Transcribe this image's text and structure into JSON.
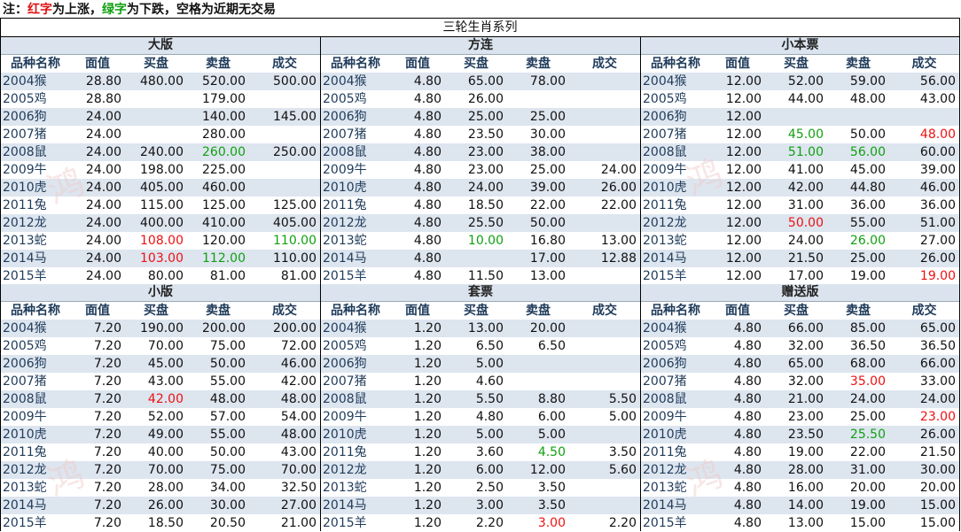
{
  "note": {
    "prefix": "注：",
    "red_word": "红字",
    "mid1": "为上涨，",
    "green_word": "绿字",
    "mid2": "为下跌，空格为近期无交易"
  },
  "title": "三轮生肖系列",
  "headers": [
    "品种名称",
    "面值",
    "买盘",
    "卖盘",
    "成交"
  ],
  "colors": {
    "up": "#ee1111",
    "down": "#11a011",
    "stripe": "#dde5ef",
    "header_text": "#1f3b5a"
  },
  "panels": [
    {
      "name": "大版",
      "rows": [
        {
          "cells": [
            "2004猴",
            "28.80",
            "480.00",
            "520.00",
            "500.00"
          ]
        },
        {
          "cells": [
            "2005鸡",
            "28.80",
            "",
            "179.00",
            ""
          ]
        },
        {
          "cells": [
            "2006狗",
            "24.00",
            "",
            "140.00",
            "145.00"
          ]
        },
        {
          "cells": [
            "2007猪",
            "24.00",
            "",
            "280.00",
            ""
          ]
        },
        {
          "cells": [
            "2008鼠",
            "24.00",
            "240.00",
            "260.00",
            "250.00"
          ],
          "colors": {
            "3": "green"
          }
        },
        {
          "cells": [
            "2009牛",
            "24.00",
            "198.00",
            "225.00",
            ""
          ]
        },
        {
          "cells": [
            "2010虎",
            "24.00",
            "405.00",
            "460.00",
            ""
          ]
        },
        {
          "cells": [
            "2011兔",
            "24.00",
            "115.00",
            "125.00",
            "125.00"
          ]
        },
        {
          "cells": [
            "2012龙",
            "24.00",
            "400.00",
            "410.00",
            "405.00"
          ]
        },
        {
          "cells": [
            "2013蛇",
            "24.00",
            "108.00",
            "120.00",
            "110.00"
          ],
          "colors": {
            "2": "red",
            "4": "green"
          }
        },
        {
          "cells": [
            "2014马",
            "24.00",
            "103.00",
            "112.00",
            "110.00"
          ],
          "colors": {
            "2": "red",
            "3": "green"
          }
        },
        {
          "cells": [
            "2015羊",
            "24.00",
            "80.00",
            "81.00",
            "81.00"
          ]
        }
      ]
    },
    {
      "name": "方连",
      "rows": [
        {
          "cells": [
            "2004猴",
            "4.80",
            "65.00",
            "78.00",
            ""
          ]
        },
        {
          "cells": [
            "2005鸡",
            "4.80",
            "26.00",
            "",
            ""
          ]
        },
        {
          "cells": [
            "2006狗",
            "4.80",
            "25.00",
            "25.00",
            ""
          ]
        },
        {
          "cells": [
            "2007猪",
            "4.80",
            "23.50",
            "30.00",
            ""
          ]
        },
        {
          "cells": [
            "2008鼠",
            "4.80",
            "23.00",
            "38.00",
            ""
          ]
        },
        {
          "cells": [
            "2009牛",
            "4.80",
            "23.00",
            "25.00",
            "24.00"
          ]
        },
        {
          "cells": [
            "2010虎",
            "4.80",
            "24.00",
            "39.00",
            "26.00"
          ]
        },
        {
          "cells": [
            "2011兔",
            "4.80",
            "18.50",
            "22.00",
            "22.00"
          ]
        },
        {
          "cells": [
            "2012龙",
            "4.80",
            "25.50",
            "50.00",
            ""
          ]
        },
        {
          "cells": [
            "2013蛇",
            "4.80",
            "10.00",
            "16.80",
            "13.00"
          ],
          "colors": {
            "2": "green"
          }
        },
        {
          "cells": [
            "2014马",
            "4.80",
            "",
            "17.00",
            "12.88"
          ]
        },
        {
          "cells": [
            "2015羊",
            "4.80",
            "11.50",
            "13.00",
            ""
          ]
        }
      ]
    },
    {
      "name": "小本票",
      "rows": [
        {
          "cells": [
            "2004猴",
            "12.00",
            "52.00",
            "59.00",
            "56.00"
          ]
        },
        {
          "cells": [
            "2005鸡",
            "12.00",
            "44.00",
            "48.00",
            "43.00"
          ]
        },
        {
          "cells": [
            "2006狗",
            "12.00",
            "",
            "",
            ""
          ]
        },
        {
          "cells": [
            "2007猪",
            "12.00",
            "45.00",
            "50.00",
            "48.00"
          ],
          "colors": {
            "2": "green",
            "4": "red"
          }
        },
        {
          "cells": [
            "2008鼠",
            "12.00",
            "51.00",
            "56.00",
            "60.00"
          ],
          "colors": {
            "2": "green",
            "3": "green"
          }
        },
        {
          "cells": [
            "2009牛",
            "12.00",
            "41.00",
            "45.00",
            "39.00"
          ]
        },
        {
          "cells": [
            "2010虎",
            "12.00",
            "42.00",
            "44.80",
            "46.00"
          ]
        },
        {
          "cells": [
            "2011兔",
            "12.00",
            "31.00",
            "36.00",
            "36.00"
          ]
        },
        {
          "cells": [
            "2012龙",
            "12.00",
            "50.00",
            "55.00",
            "51.00"
          ],
          "colors": {
            "2": "red"
          }
        },
        {
          "cells": [
            "2013蛇",
            "12.00",
            "24.00",
            "26.00",
            "27.00"
          ],
          "colors": {
            "3": "green"
          }
        },
        {
          "cells": [
            "2014马",
            "12.00",
            "21.50",
            "25.00",
            "26.00"
          ]
        },
        {
          "cells": [
            "2015羊",
            "12.00",
            "17.00",
            "19.00",
            "19.00"
          ],
          "colors": {
            "4": "red"
          }
        }
      ]
    },
    {
      "name": "小版",
      "rows": [
        {
          "cells": [
            "2004猴",
            "7.20",
            "190.00",
            "200.00",
            "200.00"
          ]
        },
        {
          "cells": [
            "2005鸡",
            "7.20",
            "70.00",
            "75.00",
            "72.00"
          ]
        },
        {
          "cells": [
            "2006狗",
            "7.20",
            "45.00",
            "50.00",
            "46.00"
          ]
        },
        {
          "cells": [
            "2007猪",
            "7.20",
            "43.00",
            "55.00",
            "42.00"
          ]
        },
        {
          "cells": [
            "2008鼠",
            "7.20",
            "42.00",
            "48.00",
            "48.00"
          ],
          "colors": {
            "2": "red"
          }
        },
        {
          "cells": [
            "2009牛",
            "7.20",
            "52.00",
            "57.00",
            "54.00"
          ]
        },
        {
          "cells": [
            "2010虎",
            "7.20",
            "49.00",
            "55.00",
            "48.00"
          ]
        },
        {
          "cells": [
            "2011兔",
            "7.20",
            "40.00",
            "50.00",
            "43.00"
          ]
        },
        {
          "cells": [
            "2012龙",
            "7.20",
            "70.00",
            "75.00",
            "70.00"
          ]
        },
        {
          "cells": [
            "2013蛇",
            "7.20",
            "28.00",
            "34.00",
            "32.50"
          ]
        },
        {
          "cells": [
            "2014马",
            "7.20",
            "26.00",
            "30.00",
            "27.00"
          ]
        },
        {
          "cells": [
            "2015羊",
            "7.20",
            "18.50",
            "20.50",
            "21.00"
          ]
        }
      ]
    },
    {
      "name": "套票",
      "rows": [
        {
          "cells": [
            "2004猴",
            "1.20",
            "13.00",
            "20.00",
            ""
          ]
        },
        {
          "cells": [
            "2005鸡",
            "1.20",
            "6.50",
            "6.50",
            ""
          ]
        },
        {
          "cells": [
            "2006狗",
            "1.20",
            "5.00",
            "",
            ""
          ]
        },
        {
          "cells": [
            "2007猪",
            "1.20",
            "4.60",
            "",
            ""
          ]
        },
        {
          "cells": [
            "2008鼠",
            "1.20",
            "5.50",
            "8.80",
            "5.50"
          ]
        },
        {
          "cells": [
            "2009牛",
            "1.20",
            "4.80",
            "6.00",
            "5.00"
          ]
        },
        {
          "cells": [
            "2010虎",
            "1.20",
            "5.00",
            "5.00",
            ""
          ]
        },
        {
          "cells": [
            "2011兔",
            "1.20",
            "3.60",
            "4.50",
            "3.50"
          ],
          "colors": {
            "3": "green"
          }
        },
        {
          "cells": [
            "2012龙",
            "1.20",
            "6.00",
            "12.00",
            "5.60"
          ]
        },
        {
          "cells": [
            "2013蛇",
            "1.20",
            "2.50",
            "3.50",
            ""
          ]
        },
        {
          "cells": [
            "2014马",
            "1.20",
            "3.00",
            "3.50",
            ""
          ]
        },
        {
          "cells": [
            "2015羊",
            "1.20",
            "2.20",
            "3.00",
            "2.20"
          ],
          "colors": {
            "3": "red"
          }
        }
      ]
    },
    {
      "name": "赠送版",
      "rows": [
        {
          "cells": [
            "2004猴",
            "4.80",
            "66.00",
            "85.00",
            "65.00"
          ]
        },
        {
          "cells": [
            "2005鸡",
            "4.80",
            "32.00",
            "36.50",
            "36.50"
          ]
        },
        {
          "cells": [
            "2006狗",
            "4.80",
            "65.00",
            "68.00",
            "66.00"
          ]
        },
        {
          "cells": [
            "2007猪",
            "4.80",
            "32.00",
            "35.00",
            "33.00"
          ],
          "colors": {
            "3": "red"
          }
        },
        {
          "cells": [
            "2008鼠",
            "4.80",
            "21.00",
            "24.00",
            "24.00"
          ]
        },
        {
          "cells": [
            "2009牛",
            "4.80",
            "23.00",
            "25.00",
            "23.00"
          ],
          "colors": {
            "4": "red"
          }
        },
        {
          "cells": [
            "2010虎",
            "4.80",
            "23.50",
            "25.50",
            "26.00"
          ],
          "colors": {
            "3": "green"
          }
        },
        {
          "cells": [
            "2011兔",
            "4.80",
            "19.00",
            "22.00",
            "21.50"
          ]
        },
        {
          "cells": [
            "2012龙",
            "4.80",
            "28.00",
            "31.00",
            "30.00"
          ]
        },
        {
          "cells": [
            "2013蛇",
            "4.80",
            "16.00",
            "20.00",
            "20.00"
          ]
        },
        {
          "cells": [
            "2014马",
            "4.80",
            "14.00",
            "19.00",
            "15.00"
          ]
        },
        {
          "cells": [
            "2015羊",
            "4.80",
            "13.00",
            "15.00",
            "15.00"
          ]
        }
      ]
    }
  ]
}
